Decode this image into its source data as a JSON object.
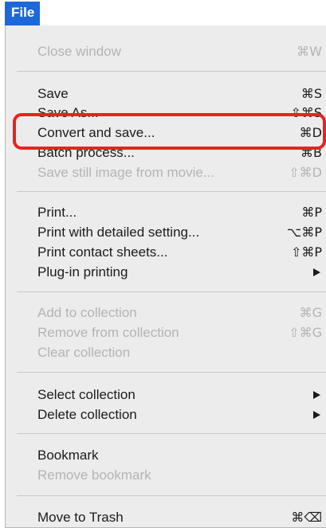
{
  "menu": {
    "title": "File",
    "accent_color": "#1d68d8",
    "highlight_color": "#e8231d",
    "items": [
      {
        "label": "Close window",
        "shortcut": "⌘W",
        "enabled": false
      },
      {
        "label": "Save",
        "shortcut": "⌘S",
        "enabled": true
      },
      {
        "label": "Save As...",
        "shortcut": "⇧⌘S",
        "enabled": true
      },
      {
        "label": "Convert and save...",
        "shortcut": "⌘D",
        "enabled": true,
        "highlighted": true
      },
      {
        "label": "Batch process...",
        "shortcut": "⌘B",
        "enabled": true
      },
      {
        "label": "Save still image from movie...",
        "shortcut": "⇧⌘D",
        "enabled": false
      },
      {
        "label": "Print...",
        "shortcut": "⌘P",
        "enabled": true
      },
      {
        "label": "Print with detailed setting...",
        "shortcut": "⌥⌘P",
        "enabled": true
      },
      {
        "label": "Print contact sheets...",
        "shortcut": "⇧⌘P",
        "enabled": true
      },
      {
        "label": "Plug-in printing",
        "submenu": true,
        "enabled": true
      },
      {
        "label": "Add to collection",
        "shortcut": "⌘G",
        "enabled": false
      },
      {
        "label": "Remove from collection",
        "shortcut": "⇧⌘G",
        "enabled": false
      },
      {
        "label": "Clear collection",
        "enabled": false
      },
      {
        "label": "Select collection",
        "submenu": true,
        "enabled": true
      },
      {
        "label": "Delete collection",
        "submenu": true,
        "enabled": true
      },
      {
        "label": "Bookmark",
        "enabled": true
      },
      {
        "label": "Remove bookmark",
        "enabled": false
      },
      {
        "label": "Move to Trash",
        "shortcut": "⌘⌫",
        "enabled": true
      }
    ]
  }
}
